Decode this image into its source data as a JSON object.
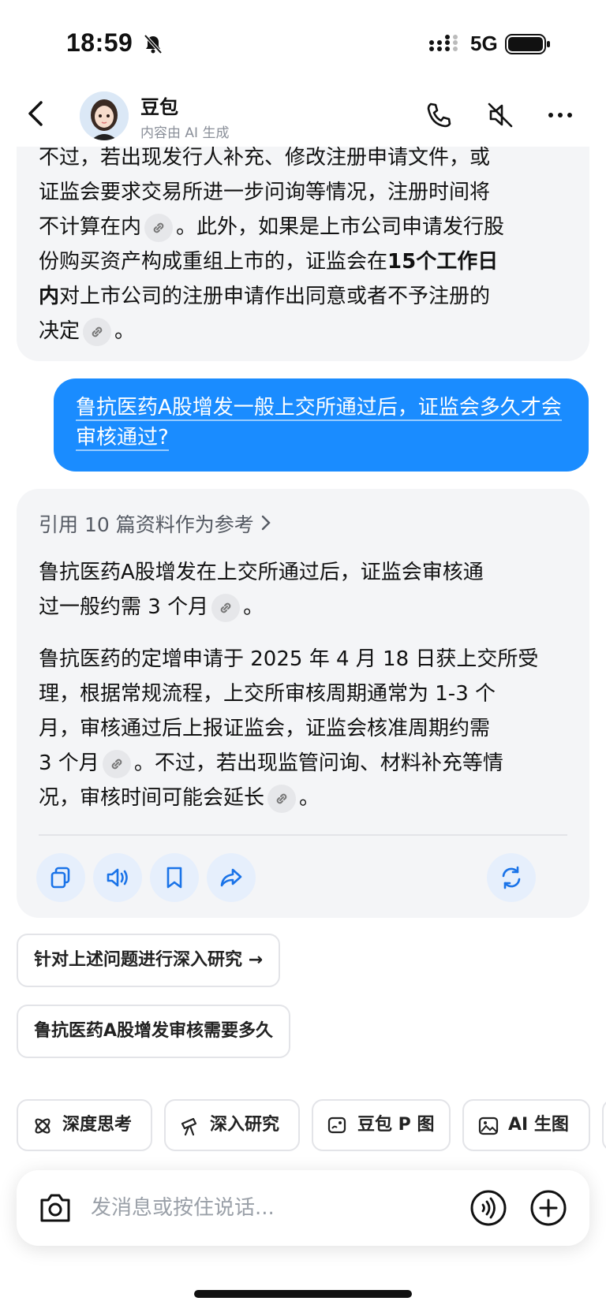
{
  "status": {
    "time": "18:59",
    "network": "5G"
  },
  "header": {
    "name": "豆包",
    "subtitle": "内容由 AI 生成"
  },
  "ai_message_1": {
    "line1": "不过，若出现发行人补充、修改注册申请文件，或",
    "line2": "证监会要求交易所进一步问询等情况，注册时间将",
    "line3a": "不计算在内",
    "line3b": "。此外，如果是上市公司申请发行股",
    "line4a": "份购买资产构成重组上市的，证监会在",
    "line4b": "15个工作日",
    "line5a": "内",
    "line5b": "对上市公司的注册申请作出同意或者不予注册的",
    "line6a": "决定",
    "line6b": "。"
  },
  "user_message": {
    "text": "鲁抗医药A股增发一般上交所通过后，证监会多久才会审核通过?"
  },
  "ai_message_2": {
    "refs_label": "引用 10 篇资料作为参考",
    "p1_line1": "鲁抗医药A股增发在上交所通过后，证监会审核通",
    "p1_line2a": "过一般约需 3 个月",
    "p1_line2b": "。",
    "p2_line1": "鲁抗医药的定增申请于 2025 年 4 月 18 日获上交所受",
    "p2_line2": "理，根据常规流程，上交所审核周期通常为 1-3 个",
    "p2_line3": "月，审核通过后上报证监会，证监会核准周期约需",
    "p2_line4a": "3 个月",
    "p2_line4b": "。不过，若出现监管问询、材料补充等情",
    "p2_line5a": "况，审核时间可能会延长",
    "p2_line5b": "。"
  },
  "suggestions": [
    "针对上述问题进行深入研究 →",
    "鲁抗医药A股增发审核需要多久"
  ],
  "chips": [
    "深度思考",
    "深入研究",
    "豆包 P 图",
    "AI 生图"
  ],
  "composer": {
    "placeholder": "发消息或按住说话..."
  },
  "colors": {
    "accent": "#1a8cff",
    "bubble_bg": "#f4f5f7",
    "action_bg": "#e6effc"
  }
}
